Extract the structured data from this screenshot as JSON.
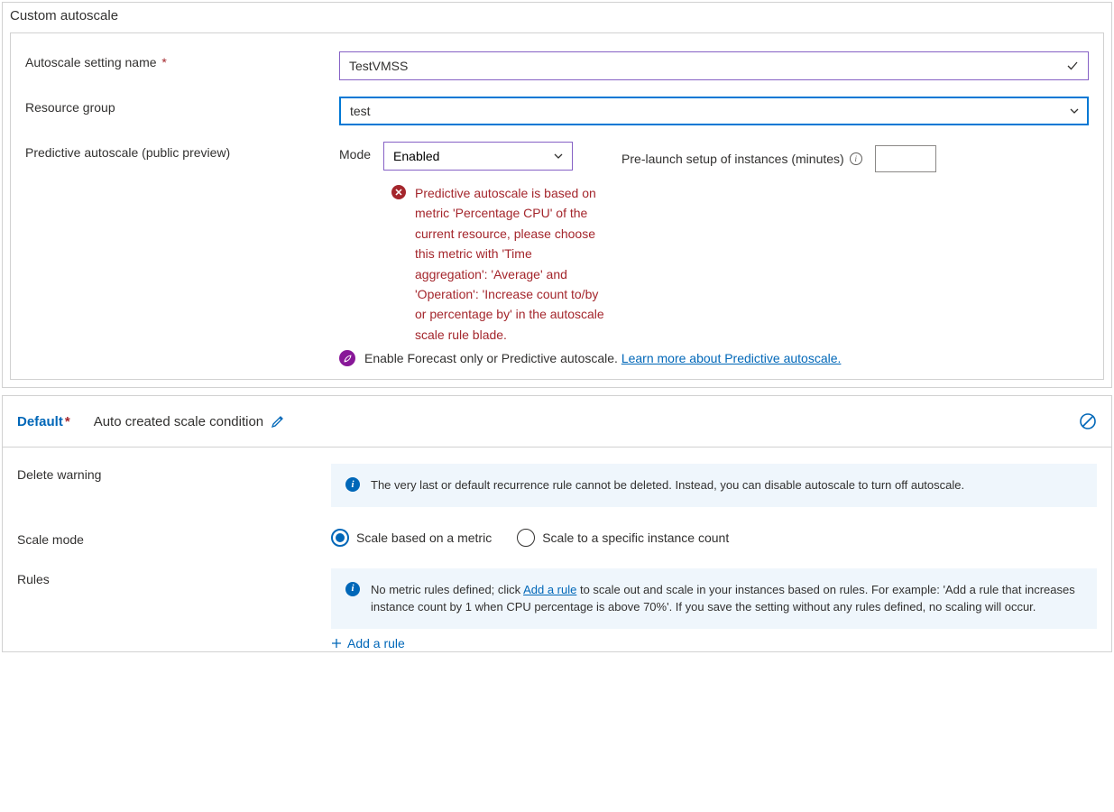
{
  "panel": {
    "title": "Custom autoscale",
    "settingNameLabel": "Autoscale setting name",
    "settingNameValue": "TestVMSS",
    "resourceGroupLabel": "Resource group",
    "resourceGroupValue": "test",
    "predictiveLabel": "Predictive autoscale (public preview)",
    "modeLabel": "Mode",
    "modeValue": "Enabled",
    "preLaunchLabel": "Pre-launch setup of instances (minutes)",
    "preLaunchValue": "",
    "errorText": "Predictive autoscale is based on metric 'Percentage CPU' of the current resource, please choose this metric with 'Time aggregation': 'Average' and 'Operation': 'Increase count to/by or percentage by' in the autoscale scale rule blade.",
    "forecastText": "Enable Forecast only or Predictive autoscale. ",
    "forecastLink": "Learn more about Predictive autoscale."
  },
  "condition": {
    "title": "Default",
    "subtitle": "Auto created scale condition",
    "deleteWarningLabel": "Delete warning",
    "deleteWarningText": "The very last or default recurrence rule cannot be deleted. Instead, you can disable autoscale to turn off autoscale.",
    "scaleModeLabel": "Scale mode",
    "scaleModeOptions": [
      "Scale based on a metric",
      "Scale to a specific instance count"
    ],
    "rulesLabel": "Rules",
    "rulesInfoPre": "No metric rules defined; click ",
    "rulesInfoLink": "Add a rule",
    "rulesInfoPost": " to scale out and scale in your instances based on rules. For example: 'Add a rule that increases instance count by 1 when CPU percentage is above 70%'. If you save the setting without any rules defined, no scaling will occur.",
    "addRule": "Add a rule"
  }
}
